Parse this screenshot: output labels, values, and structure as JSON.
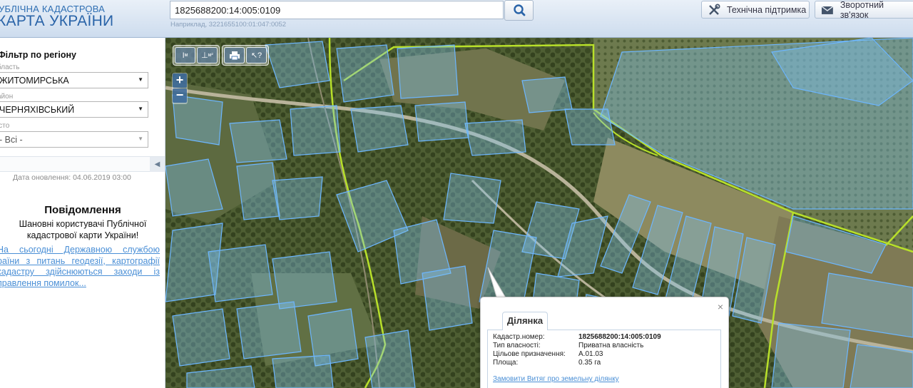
{
  "header": {
    "brand_top": "УБЛІЧНА КАДАСТРОВА",
    "brand_main": "КАРТА УКРАЇНИ",
    "search_value": "1825688200:14:005:0109",
    "search_hint": "Наприклад, 3221655100:01:047:0052",
    "support_label": "Технічна підтримка",
    "feedback_label": "Зворотний зв'язок"
  },
  "sidebar": {
    "filter_title": "Фільтр по регіону",
    "oblast_label": "бласть",
    "oblast_value": "ЖИТОМИРСЬКА",
    "rayon_label": "айон",
    "rayon_value": "ЧЕРНЯХІВСЬКИЙ",
    "misto_label": "істо",
    "misto_value": "- Всі -",
    "update_date": "Дата оновлення: 04.06.2019 03:00",
    "notice_title": "Повідомлення",
    "notice_text": "Шановні користувачі Публічної кадастрової карти України!",
    "notice_link": "На сьогодні Державною службою раїни з питань геодезії, картографії кадастру здійснюються заходи із правлення помилок..."
  },
  "map": {
    "zoom_in": "+",
    "zoom_out": "−",
    "tools": [
      "ruler-length-tool",
      "ruler-area-tool",
      "print-tool",
      "identify-tool"
    ]
  },
  "popup": {
    "tab_label": "Ділянка",
    "close_label": "×",
    "rows": [
      {
        "key": "Кадастр.номер:",
        "value": "1825688200:14:005:0109"
      },
      {
        "key": "Тип власності:",
        "value": "Приватна власність"
      },
      {
        "key": "Цільове призначення:",
        "value": "A.01.03"
      },
      {
        "key": "Площа:",
        "value": "0.35 га"
      }
    ],
    "link": "Замовити Витяг про земельну ділянку"
  },
  "colors": {
    "accent": "#2a64a8",
    "parcel_fill": "#7ec3f0",
    "parcel_stroke": "#6cb6ff",
    "boundary": "#b8e02a",
    "link": "#4a8fd6"
  }
}
